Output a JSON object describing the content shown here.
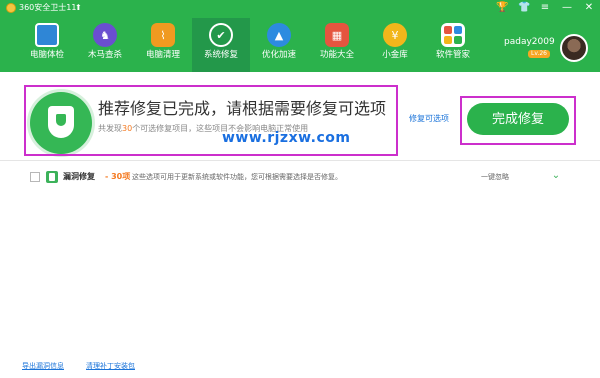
{
  "titlebar": {
    "title": "360安全卫士11",
    "update_glyph": "⬆",
    "controls": [
      "🏆",
      "👕",
      "≡",
      "—",
      "✕"
    ]
  },
  "nav": {
    "items": [
      {
        "label": "电脑体检",
        "icon": "monitor-icon"
      },
      {
        "label": "木马查杀",
        "icon": "trojan-horse-icon"
      },
      {
        "label": "电脑清理",
        "icon": "broom-icon"
      },
      {
        "label": "系统修复",
        "icon": "shield-icon",
        "active": true
      },
      {
        "label": "优化加速",
        "icon": "rocket-icon"
      },
      {
        "label": "功能大全",
        "icon": "apps-grid-icon"
      },
      {
        "label": "小金库",
        "icon": "coin-icon"
      },
      {
        "label": "软件管家",
        "icon": "software-store-icon"
      }
    ]
  },
  "user": {
    "name": "paday2009",
    "level": "Lv.26"
  },
  "banner": {
    "title": "推荐修复已完成，请根据需要修复可选项",
    "subtitle_prefix": "共发现",
    "subtitle_count": "30",
    "subtitle_suffix": "个可选修复项目，这些项目不会影响电脑正常使用",
    "watermark": "www.rjzxw.com",
    "repairable_link": "修复可选项",
    "finish_button": "完成修复"
  },
  "item": {
    "title": "漏洞修复",
    "count": "- 30项",
    "description": "这些选项可用于更新系统或软件功能，您可根据需要选择是否修复。",
    "ignore": "一键忽略"
  },
  "footer": {
    "link1": "导出漏洞信息",
    "link2": "清理补丁安装包"
  },
  "colors": {
    "brand_green": "#2bb24c",
    "highlight_magenta": "#cc2fcc",
    "count_orange": "#f47920",
    "link_blue": "#1a73d9"
  }
}
